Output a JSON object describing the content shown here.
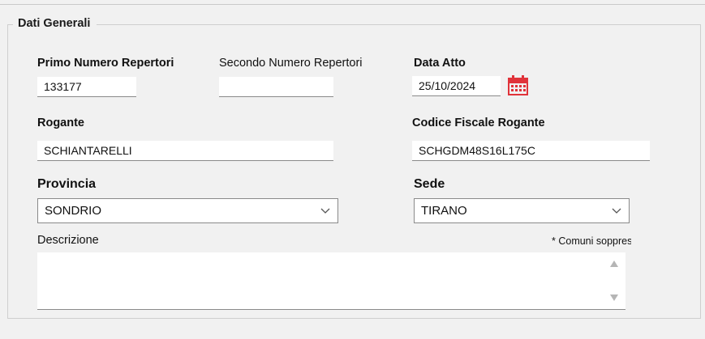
{
  "section": {
    "title": "Dati Generali"
  },
  "primo_numero": {
    "label": "Primo Numero Repertori",
    "value": "133177"
  },
  "secondo_numero": {
    "label": "Secondo Numero Repertori",
    "value": ""
  },
  "data_atto": {
    "label": "Data Atto",
    "value": "25/10/2024",
    "icon": "calendar-icon"
  },
  "rogante": {
    "label": "Rogante",
    "value": "SCHIANTARELLI"
  },
  "codice_fiscale": {
    "label": "Codice Fiscale Rogante",
    "value": "SCHGDM48S16L175C"
  },
  "provincia": {
    "label": "Provincia",
    "value": "SONDRIO"
  },
  "sede": {
    "label": "Sede",
    "value": "TIRANO"
  },
  "descrizione": {
    "label": "Descrizione",
    "value": "",
    "note": "* Comuni soppressi"
  },
  "colors": {
    "calendar": "#e0333a",
    "background": "#f1f1f1",
    "field_border": "#8a8a8a",
    "scroll_arrow": "#b5b5b5"
  }
}
